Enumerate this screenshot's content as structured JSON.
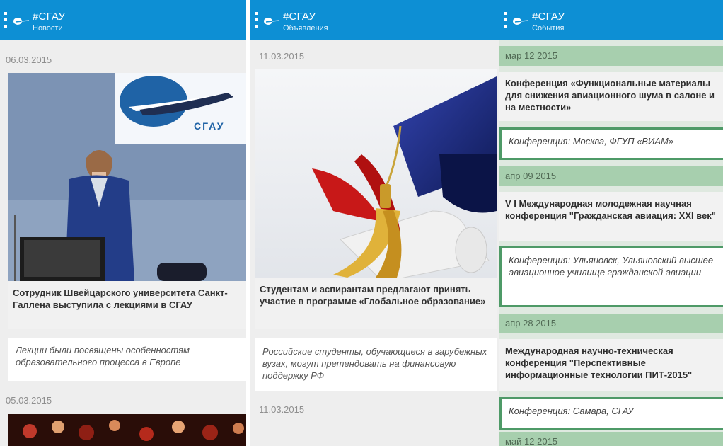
{
  "screens": [
    {
      "app_title": "#СГАУ",
      "section": "Новости",
      "items": [
        {
          "date": "06.03.2015",
          "headline": "Сотрудник Швейцарского университета Санкт-Галлена выступила с лекциями в СГАУ",
          "summary": "Лекции были посвящены особенностям образовательного процесса в Европе",
          "sign_text": "СГАУ"
        },
        {
          "date": "05.03.2015"
        }
      ]
    },
    {
      "app_title": "#СГАУ",
      "section": "Объявления",
      "items": [
        {
          "date": "11.03.2015",
          "headline": "Студентам и аспирантам предлагают принять участие в программе «Глобальное образование»",
          "summary": "Российские студенты, обучающиеся в зарубежных вузах, могут претендовать на финансовую поддержку РФ"
        },
        {
          "date": "11.03.2015"
        }
      ]
    },
    {
      "app_title": "#СГАУ",
      "section": "События",
      "events": [
        {
          "date": "мар 12 2015",
          "title": "Конференция «Функциональные материалы для снижения авиационного шума в салоне и на местности»",
          "place": "Конференция: Москва, ФГУП «ВИАМ»"
        },
        {
          "date": "апр 09 2015",
          "title": "V I Международная молодежная научная конференция \"Гражданская авиация: XXI век\"",
          "place": "Конференция: Ульяновск, Ульяновский высшее авиационное училище гражданской авиации"
        },
        {
          "date": "апр 28 2015",
          "title": "Международная научно-техническая конференция \"Перспективные информационные технологии ПИТ-2015\"",
          "place": "Конференция: Самара, СГАУ"
        },
        {
          "date": "май 12 2015"
        }
      ]
    }
  ],
  "colors": {
    "appbar": "#0d8fd4",
    "event_date_bg": "#a7cfae",
    "event_border": "#4e9a67"
  }
}
